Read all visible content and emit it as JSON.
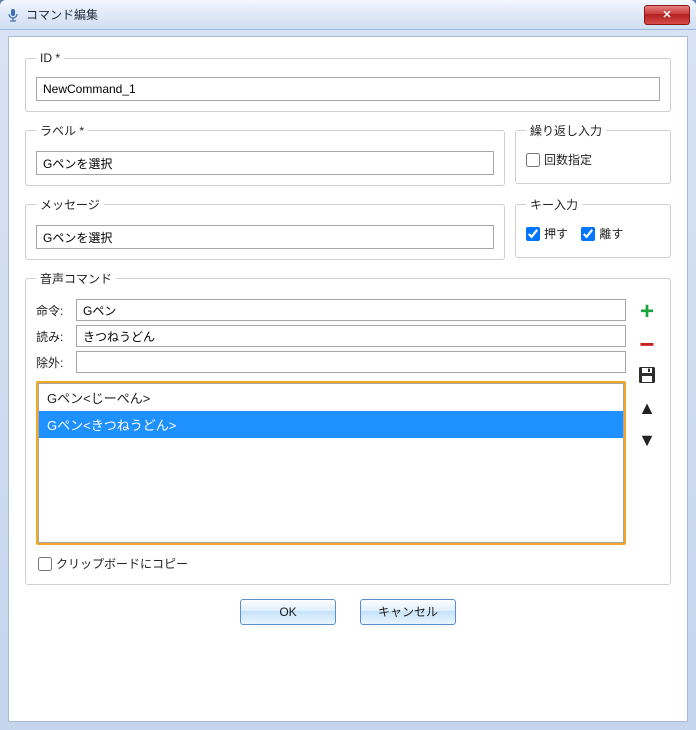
{
  "window": {
    "title": "コマンド編集"
  },
  "id_group": {
    "legend": "ID *",
    "value": "NewCommand_1"
  },
  "label_group": {
    "legend": "ラベル *",
    "value": "Gペンを選択"
  },
  "message_group": {
    "legend": "メッセージ",
    "value": "Gペンを選択"
  },
  "repeat_group": {
    "legend": "繰り返し入力",
    "count_label": "回数指定",
    "count_checked": false
  },
  "key_group": {
    "legend": "キー入力",
    "press_label": "押す",
    "press_checked": true,
    "release_label": "離す",
    "release_checked": true
  },
  "voice_group": {
    "legend": "音声コマンド",
    "command_label": "命令:",
    "command_value": "Gペン",
    "reading_label": "読み:",
    "reading_value": "きつねうどん",
    "exclude_label": "除外:",
    "exclude_value": "",
    "list": [
      {
        "text": "Gペン<じーぺん>",
        "selected": false
      },
      {
        "text": "Gペン<きつねうどん>",
        "selected": true
      }
    ]
  },
  "clipboard": {
    "label": "クリップボードにコピー",
    "checked": false
  },
  "footer": {
    "ok": "OK",
    "cancel": "キャンセル"
  },
  "icons": {
    "add": "add-icon",
    "remove": "remove-icon",
    "save": "save-icon",
    "up": "arrow-up-icon",
    "down": "arrow-down-icon",
    "close": "close-icon",
    "mic": "mic-icon"
  }
}
